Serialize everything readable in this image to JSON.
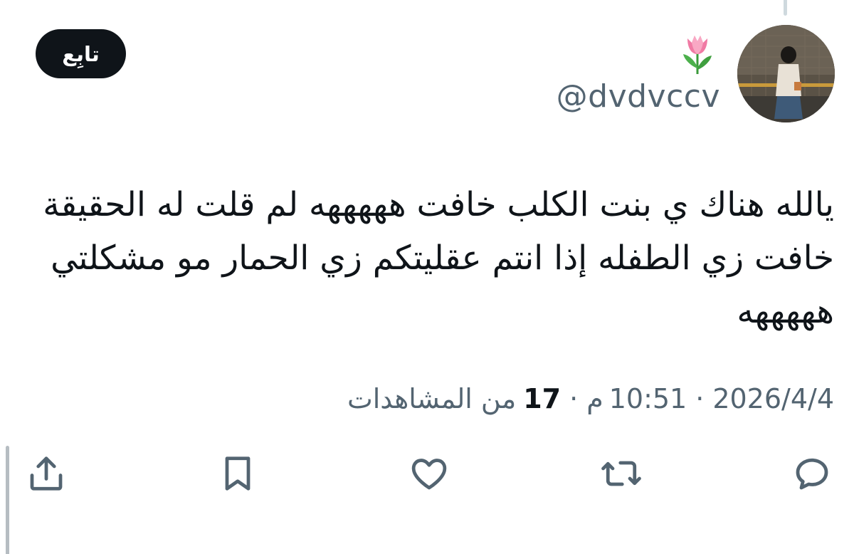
{
  "follow_button": {
    "label": "تابِع"
  },
  "user": {
    "handle": "@dvdvccv",
    "badge_emoji": "tulip-icon",
    "avatar": "avatar"
  },
  "tweet": {
    "text": "يالله هناك ي بنت الكلب خافت هههههه لم قلت له الحقيقة خافت زي الطفله إذا انتم عقليتكم زي الحمار مو مشكلتي هههههه"
  },
  "meta": {
    "date": "2026/4/4",
    "time": "10:51",
    "period": "م",
    "views_count": "17",
    "views_label": "من المشاهدات",
    "separator": "·"
  },
  "actions": [
    {
      "name": "reply",
      "icon": "reply-icon"
    },
    {
      "name": "repost",
      "icon": "repost-icon"
    },
    {
      "name": "like",
      "icon": "heart-icon"
    },
    {
      "name": "bookmark",
      "icon": "bookmark-icon"
    },
    {
      "name": "share",
      "icon": "share-icon"
    }
  ],
  "colors": {
    "text": "#0f1419",
    "secondary": "#536471",
    "button_bg": "#0f1419",
    "button_text": "#ffffff"
  }
}
